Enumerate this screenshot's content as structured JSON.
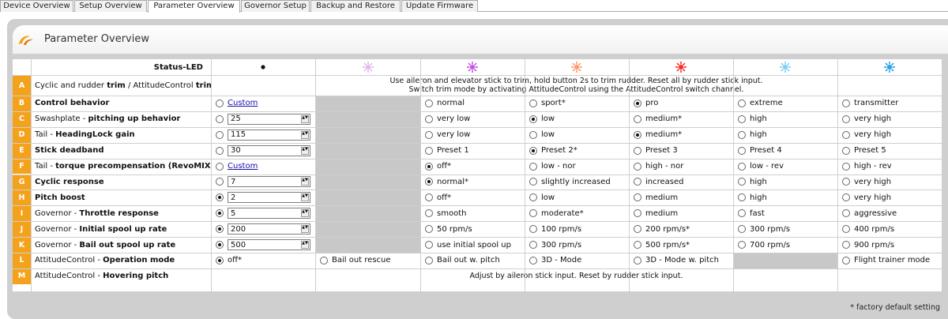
{
  "tabs": [
    "Device Overview",
    "Setup Overview",
    "Parameter Overview",
    "Governor Setup",
    "Backup and Restore",
    "Update Firmware"
  ],
  "header": {
    "title": "Parameter Overview"
  },
  "status_led": {
    "label": "Status-LED",
    "leds": [
      {
        "type": "dot",
        "color": "#111111"
      },
      {
        "type": "burst",
        "color": "#e3b6f0"
      },
      {
        "type": "burst",
        "color": "#c355e6"
      },
      {
        "type": "burst",
        "color": "#ff9b6a"
      },
      {
        "type": "burst",
        "color": "#ff2a2a"
      },
      {
        "type": "burst",
        "color": "#7fcef5"
      },
      {
        "type": "burst",
        "color": "#2a9fe6"
      }
    ]
  },
  "rows": [
    {
      "letter": "A",
      "kind": "desc",
      "label_parts": [
        [
          "Cyclic and rudder ",
          false
        ],
        [
          "trim",
          true
        ],
        [
          " / AttitudeControl ",
          false
        ],
        [
          "trim",
          true
        ]
      ],
      "desc": [
        "Use aileron and elevator stick to trim, hold button 2s to trim rudder. Reset all by rudder stick input.",
        "Switch trim mode by activating AttitudeControl using the AttitudeControl switch channel."
      ]
    },
    {
      "letter": "B",
      "kind": "opts",
      "label_parts": [
        [
          "Control behavior",
          true
        ]
      ],
      "custom": {
        "type": "link",
        "text": "Custom",
        "checked": false
      },
      "gray": true,
      "options": [
        {
          "text": "normal",
          "checked": false
        },
        {
          "text": "sport*",
          "checked": false
        },
        {
          "text": "pro",
          "checked": true
        },
        {
          "text": "extreme",
          "checked": false
        },
        {
          "text": "transmitter",
          "checked": false
        }
      ]
    },
    {
      "letter": "C",
      "kind": "opts",
      "label_parts": [
        [
          "Swashplate - ",
          false
        ],
        [
          "pitching up behavior",
          true
        ]
      ],
      "custom": {
        "type": "spin",
        "text": "25",
        "checked": false
      },
      "gray": true,
      "options": [
        {
          "text": "very low",
          "checked": false
        },
        {
          "text": "low",
          "checked": true
        },
        {
          "text": "medium*",
          "checked": false
        },
        {
          "text": "high",
          "checked": false
        },
        {
          "text": "very high",
          "checked": false
        }
      ]
    },
    {
      "letter": "D",
      "kind": "opts",
      "label_parts": [
        [
          "Tail - ",
          false
        ],
        [
          "HeadingLock gain",
          true
        ]
      ],
      "custom": {
        "type": "spin",
        "text": "115",
        "checked": false
      },
      "gray": true,
      "options": [
        {
          "text": "very low",
          "checked": false
        },
        {
          "text": "low",
          "checked": false
        },
        {
          "text": "medium*",
          "checked": true
        },
        {
          "text": "high",
          "checked": false
        },
        {
          "text": "very high",
          "checked": false
        }
      ]
    },
    {
      "letter": "E",
      "kind": "opts",
      "label_parts": [
        [
          "Stick deadband",
          true
        ]
      ],
      "custom": {
        "type": "spin",
        "text": "30",
        "checked": false
      },
      "gray": true,
      "options": [
        {
          "text": "Preset 1",
          "checked": false
        },
        {
          "text": "Preset 2*",
          "checked": true
        },
        {
          "text": "Preset 3",
          "checked": false
        },
        {
          "text": "Preset 4",
          "checked": false
        },
        {
          "text": "Preset 5",
          "checked": false
        }
      ]
    },
    {
      "letter": "F",
      "kind": "opts",
      "label_parts": [
        [
          "Tail - ",
          false
        ],
        [
          "torque precompensation (RevoMIX)",
          true
        ]
      ],
      "custom": {
        "type": "link",
        "text": "Custom",
        "checked": false
      },
      "gray": true,
      "options": [
        {
          "text": "off*",
          "checked": true
        },
        {
          "text": "low - nor",
          "checked": false
        },
        {
          "text": "high - nor",
          "checked": false
        },
        {
          "text": "low - rev",
          "checked": false
        },
        {
          "text": "high - rev",
          "checked": false
        }
      ]
    },
    {
      "letter": "G",
      "kind": "opts",
      "label_parts": [
        [
          "Cyclic response",
          true
        ]
      ],
      "custom": {
        "type": "spin",
        "text": "7",
        "checked": false
      },
      "gray": true,
      "options": [
        {
          "text": "normal*",
          "checked": true
        },
        {
          "text": "slightly increased",
          "checked": false
        },
        {
          "text": "increased",
          "checked": false
        },
        {
          "text": "high",
          "checked": false
        },
        {
          "text": "very high",
          "checked": false
        }
      ]
    },
    {
      "letter": "H",
      "kind": "opts",
      "label_parts": [
        [
          "Pitch boost",
          true
        ]
      ],
      "custom": {
        "type": "spin",
        "text": "2",
        "checked": true
      },
      "gray": true,
      "options": [
        {
          "text": "off*",
          "checked": false
        },
        {
          "text": "low",
          "checked": false
        },
        {
          "text": "medium",
          "checked": false
        },
        {
          "text": "high",
          "checked": false
        },
        {
          "text": "very high",
          "checked": false
        }
      ]
    },
    {
      "letter": "I",
      "kind": "opts",
      "label_parts": [
        [
          "Governor - ",
          false
        ],
        [
          "Throttle response",
          true
        ]
      ],
      "custom": {
        "type": "spin",
        "text": "5",
        "checked": true
      },
      "gray": true,
      "options": [
        {
          "text": "smooth",
          "checked": false
        },
        {
          "text": "moderate*",
          "checked": false
        },
        {
          "text": "medium",
          "checked": false
        },
        {
          "text": "fast",
          "checked": false
        },
        {
          "text": "aggressive",
          "checked": false
        }
      ]
    },
    {
      "letter": "J",
      "kind": "opts",
      "label_parts": [
        [
          "Governor - ",
          false
        ],
        [
          "Initial spool up rate",
          true
        ]
      ],
      "custom": {
        "type": "spin",
        "text": "200",
        "checked": true
      },
      "gray": true,
      "options": [
        {
          "text": "50 rpm/s",
          "checked": false
        },
        {
          "text": "100 rpm/s",
          "checked": false
        },
        {
          "text": "200 rpm/s*",
          "checked": false
        },
        {
          "text": "300 rpm/s",
          "checked": false
        },
        {
          "text": "400 rpm/s",
          "checked": false
        }
      ]
    },
    {
      "letter": "K",
      "kind": "opts",
      "label_parts": [
        [
          "Governor - ",
          false
        ],
        [
          "Bail out spool up rate",
          true
        ]
      ],
      "custom": {
        "type": "spin",
        "text": "500",
        "checked": true
      },
      "gray": true,
      "options": [
        {
          "text": "use initial spool up",
          "checked": false
        },
        {
          "text": "300 rpm/s",
          "checked": false
        },
        {
          "text": "500 rpm/s*",
          "checked": false
        },
        {
          "text": "700 rpm/s",
          "checked": false
        },
        {
          "text": "900 rpm/s",
          "checked": false
        }
      ]
    },
    {
      "letter": "L",
      "kind": "mode",
      "label_parts": [
        [
          "AttitudeControl - ",
          false
        ],
        [
          "Operation mode",
          true
        ]
      ],
      "cells": [
        {
          "text": "off*",
          "checked": true
        },
        {
          "text": "Bail out rescue",
          "checked": false
        },
        {
          "text": "Bail out w. pitch",
          "checked": false
        },
        {
          "text": "3D - Mode",
          "checked": false
        },
        {
          "text": "3D - Mode w. pitch",
          "checked": false
        },
        null,
        {
          "text": "Flight trainer mode",
          "checked": false
        }
      ]
    },
    {
      "letter": "M",
      "kind": "desc",
      "label_parts": [
        [
          "AttitudeControl - ",
          false
        ],
        [
          "Hovering pitch",
          true
        ]
      ],
      "desc": [
        "Adjust by aileron stick input. Reset by rudder stick input."
      ]
    }
  ],
  "footer": "* factory default setting",
  "colors": {
    "accent": "#f4a21c",
    "gray_cell": "#c8c8c8",
    "frame": "#cfcfcf",
    "border": "#cfcfcf",
    "link": "#1a0dab"
  }
}
